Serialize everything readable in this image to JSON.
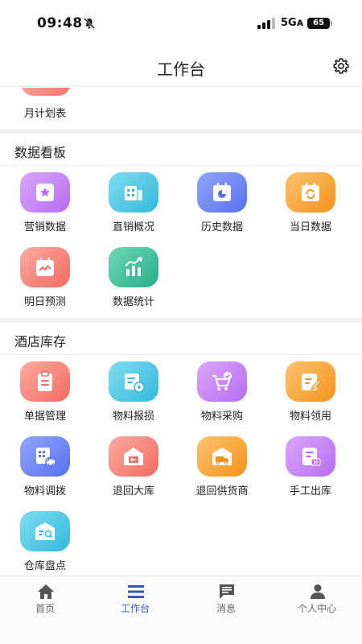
{
  "status_bar": {
    "time": "09:48",
    "network": "5Gᴀ",
    "battery": "65"
  },
  "header": {
    "title": "工作台"
  },
  "partial_item": {
    "label": "月计划表"
  },
  "sections": [
    {
      "title": "数据看板",
      "items": [
        {
          "label": "营销数据",
          "icon": "star-box-icon",
          "color": "#c57ff3"
        },
        {
          "label": "直销概况",
          "icon": "building-icon",
          "color": "#4ec9e4"
        },
        {
          "label": "历史数据",
          "icon": "calendar-chart-icon",
          "color": "#6a84f4"
        },
        {
          "label": "当日数据",
          "icon": "calendar-refresh-icon",
          "color": "#f7a23c"
        },
        {
          "label": "明日预测",
          "icon": "calendar-wave-icon",
          "color": "#f77d74"
        },
        {
          "label": "数据统计",
          "icon": "bar-trend-icon",
          "color": "#3ec19a"
        }
      ]
    },
    {
      "title": "酒店库存",
      "items": [
        {
          "label": "单据管理",
          "icon": "clipboard-icon",
          "color": "#f77d74"
        },
        {
          "label": "物料报损",
          "icon": "damage-report-icon",
          "color": "#4ec9e4"
        },
        {
          "label": "物料采购",
          "icon": "cart-check-icon",
          "color": "#c57ff3"
        },
        {
          "label": "物料领用",
          "icon": "edit-note-icon",
          "color": "#f7a23c"
        },
        {
          "label": "物料调拨",
          "icon": "transfer-icon",
          "color": "#6a84f4"
        },
        {
          "label": "退回大库",
          "icon": "warehouse-return-icon",
          "color": "#f77d74"
        },
        {
          "label": "退回供货商",
          "icon": "truck-warehouse-icon",
          "color": "#f7a23c"
        },
        {
          "label": "手工出库",
          "icon": "manual-out-icon",
          "color": "#c57ff3"
        },
        {
          "label": "仓库盘点",
          "icon": "inventory-search-icon",
          "color": "#4ec9e4"
        }
      ]
    }
  ],
  "bottom_nav": [
    {
      "label": "首页",
      "icon": "home-icon",
      "active": false
    },
    {
      "label": "工作台",
      "icon": "menu-icon",
      "active": true
    },
    {
      "label": "消息",
      "icon": "message-icon",
      "active": false
    },
    {
      "label": "个人中心",
      "icon": "person-icon",
      "active": false
    }
  ],
  "colors": {
    "accent": "#3a56c5",
    "inactive": "#666666"
  }
}
